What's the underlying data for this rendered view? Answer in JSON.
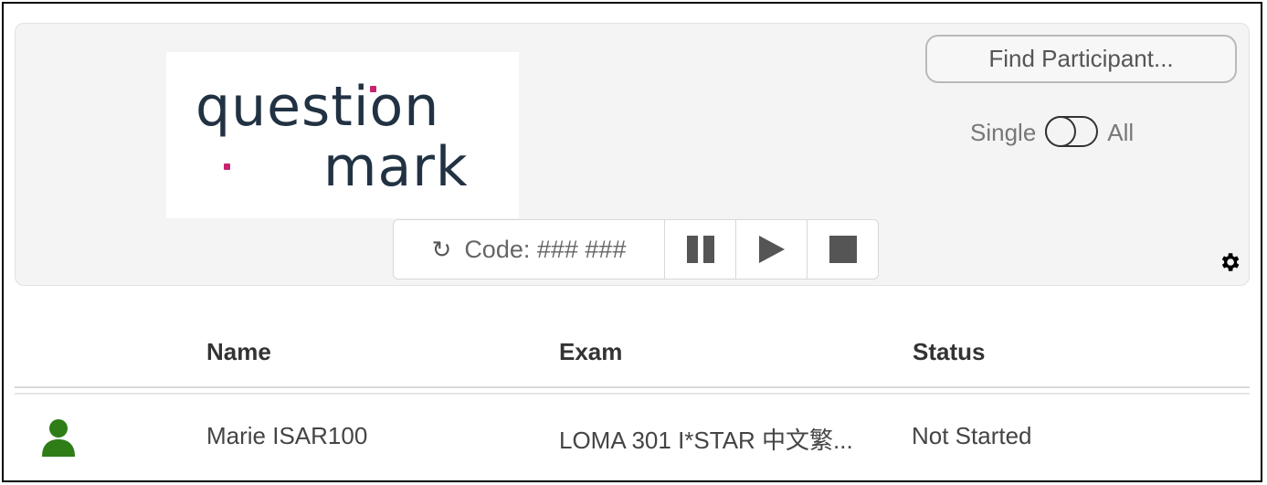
{
  "logo": {
    "line1": "question",
    "line2": "mark"
  },
  "header": {
    "find_participant_label": "Find Participant...",
    "toggle": {
      "left_label": "Single",
      "right_label": "All"
    },
    "controls": {
      "refresh_icon": "refresh-icon",
      "code_label": "Code: ### ###"
    },
    "settings_icon": "gear-icon"
  },
  "table": {
    "columns": [
      "Name",
      "Exam",
      "Status"
    ],
    "rows": [
      {
        "icon": "user-icon",
        "icon_color": "#2e7d17",
        "name": "Marie ISAR100",
        "exam": "LOMA 301 I*STAR 中文繁...",
        "status": "Not Started"
      }
    ]
  },
  "colors": {
    "accent_pink": "#c8236e",
    "logo_navy": "#213243",
    "status_green": "#2e7d17"
  }
}
